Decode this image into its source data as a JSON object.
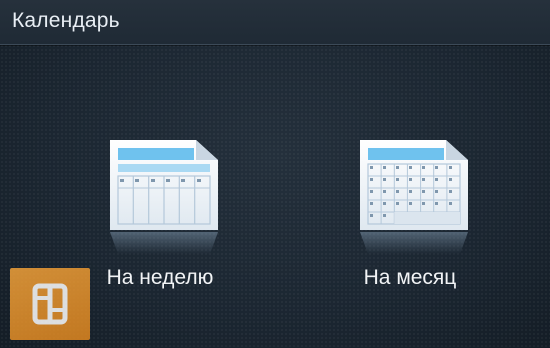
{
  "header": {
    "title": "Календарь"
  },
  "options": [
    {
      "label": "На неделю",
      "icon": "week-calendar-icon"
    },
    {
      "label": "На месяц",
      "icon": "month-calendar-icon"
    }
  ],
  "colors": {
    "background": "#1d2833",
    "calendar_header": "#6fc2ee",
    "calendar_paper": "#f2f6fa",
    "grid_lines": "#b4c8da",
    "watermark": "#e8901f"
  }
}
